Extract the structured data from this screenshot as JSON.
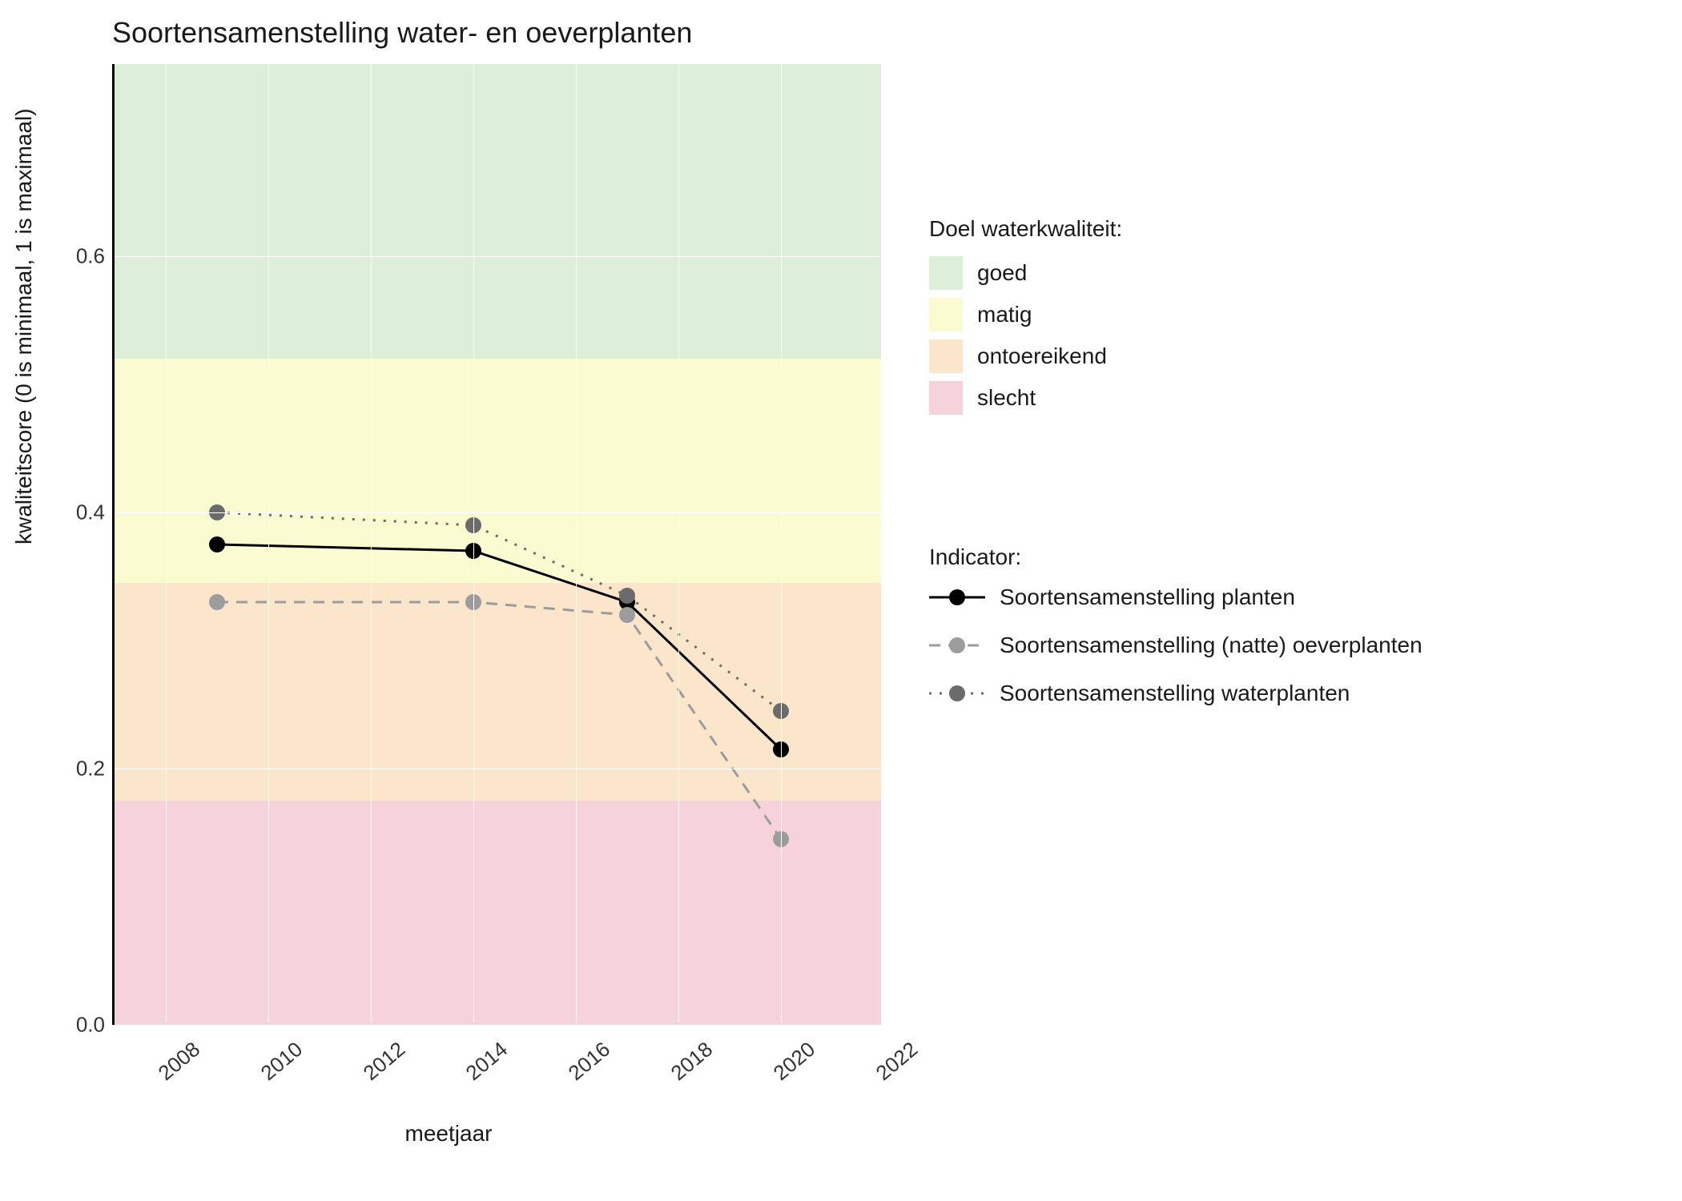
{
  "chart_data": {
    "type": "line",
    "title": "Soortensamenstelling water- en oeverplanten",
    "xlabel": "meetjaar",
    "ylabel": "kwaliteitscore (0 is minimaal, 1 is maximaal)",
    "xlim": [
      2007,
      2022
    ],
    "ylim": [
      0.0,
      0.75
    ],
    "x_ticks": [
      2008,
      2010,
      2012,
      2014,
      2016,
      2018,
      2020,
      2022
    ],
    "y_ticks": [
      0.0,
      0.2,
      0.4,
      0.6
    ],
    "x": [
      2009,
      2014,
      2017,
      2020
    ],
    "series": [
      {
        "name": "Soortensamenstelling planten",
        "values": [
          0.375,
          0.37,
          0.33,
          0.215
        ],
        "color": "#000000",
        "dash": "solid"
      },
      {
        "name": "Soortensamenstelling (natte) oeverplanten",
        "values": [
          0.33,
          0.33,
          0.32,
          0.145
        ],
        "color": "#9c9c9c",
        "dash": "dashed"
      },
      {
        "name": "Soortensamenstelling waterplanten",
        "values": [
          0.4,
          0.39,
          0.335,
          0.245
        ],
        "color": "#6b6b6b",
        "dash": "dotted"
      }
    ],
    "quality_bands": [
      {
        "name": "goed",
        "from": 0.52,
        "to": 0.75,
        "color": "#deefd9"
      },
      {
        "name": "matig",
        "from": 0.345,
        "to": 0.52,
        "color": "#fbfbd2"
      },
      {
        "name": "ontoereikend",
        "from": 0.175,
        "to": 0.345,
        "color": "#fce6cb"
      },
      {
        "name": "slecht",
        "from": 0.0,
        "to": 0.175,
        "color": "#f6d3da"
      }
    ],
    "legend_quality_title": "Doel waterkwaliteit:",
    "legend_indicator_title": "Indicator:"
  }
}
